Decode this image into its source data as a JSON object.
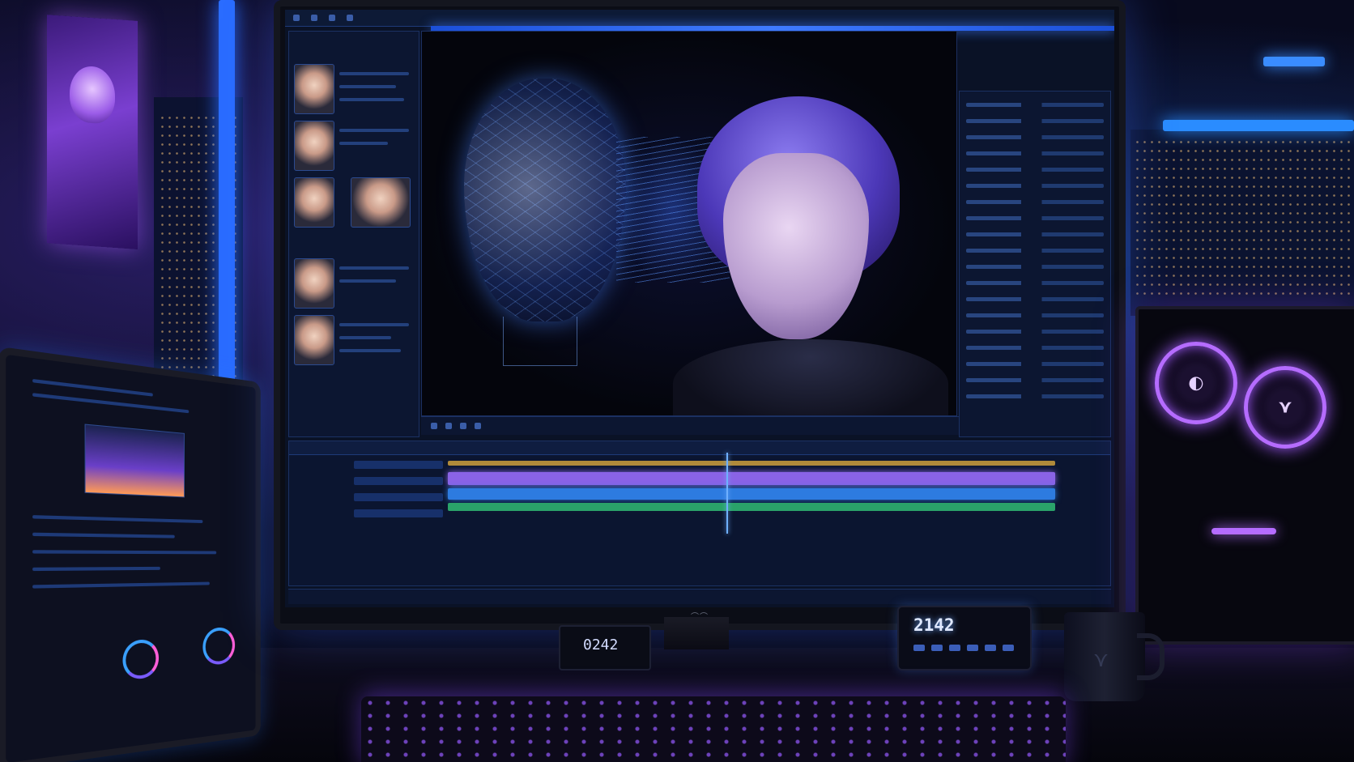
{
  "clock": {
    "digits": "2142"
  },
  "small_clock": {
    "digits": "0242"
  },
  "colors": {
    "screen_glow": "#3f7bff",
    "neon_purple": "#b56cff",
    "timeline_purple": "#8a63e6",
    "timeline_blue": "#2d7be0",
    "timeline_green": "#2aa36a"
  },
  "icons": {
    "mug_logo": "mug-logo-icon",
    "fan_logo": "fan-logo-icon"
  }
}
